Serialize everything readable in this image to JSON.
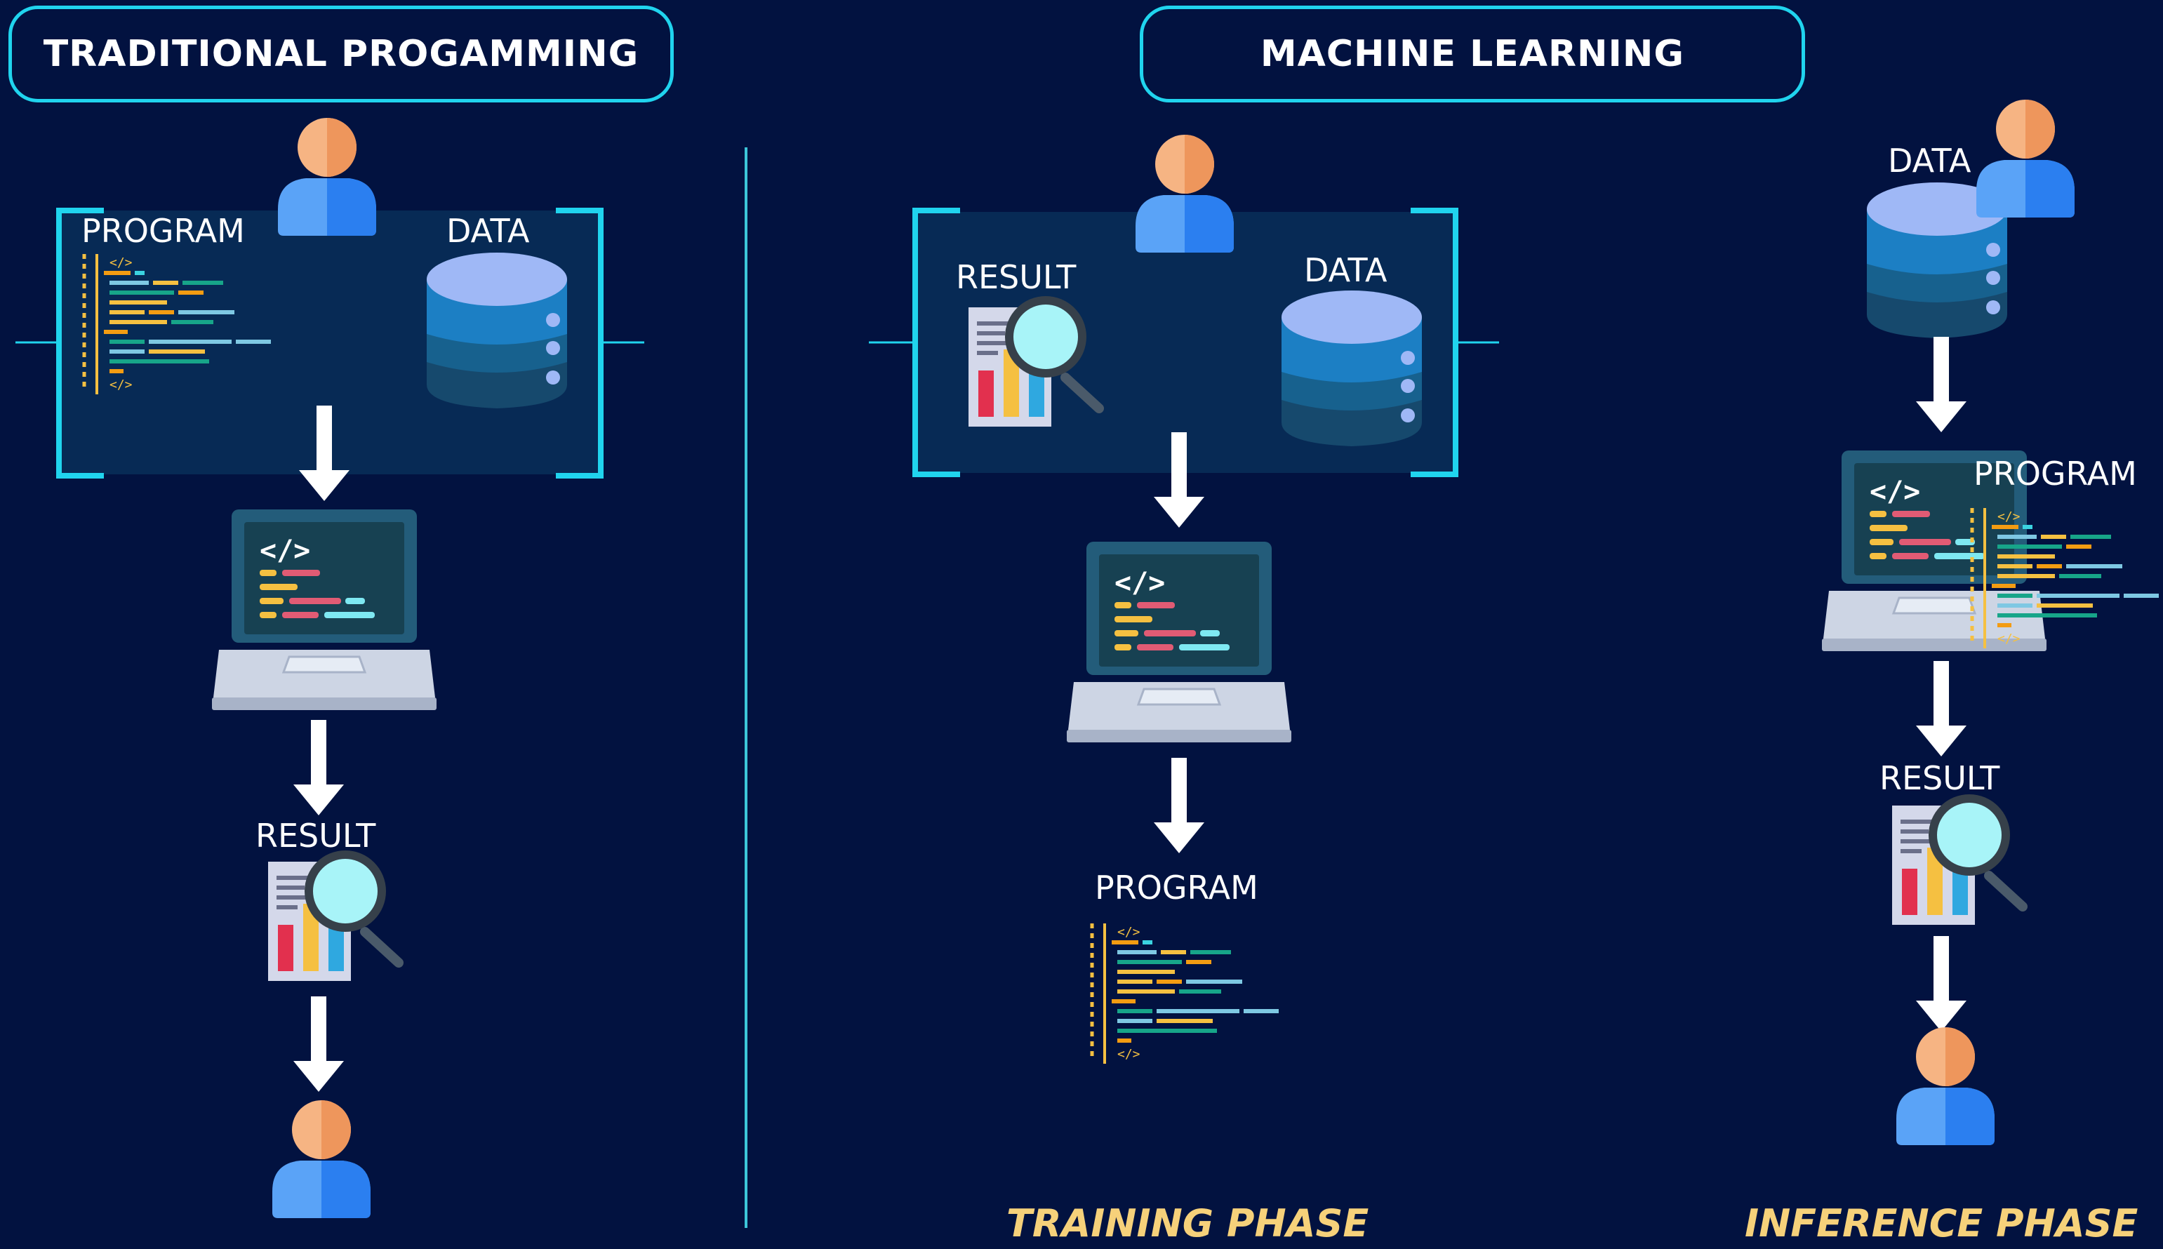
{
  "headers": {
    "traditional": "TRADITIONAL PROGAMMING",
    "ml": "MACHINE LEARNING"
  },
  "traditional": {
    "program_label": "PROGRAM",
    "data_label": "DATA",
    "result_label": "RESULT"
  },
  "training": {
    "result_label": "RESULT",
    "data_label": "DATA",
    "program_label": "PROGRAM",
    "phase_label": "TRAINING PHASE"
  },
  "inference": {
    "data_label": "DATA",
    "program_label": "PROGRAM",
    "result_label": "RESULT",
    "phase_label": "INFERENCE PHASE"
  },
  "colors": {
    "background": "#021240",
    "accent": "#20d4ee",
    "phase_text": "#f6d17a"
  }
}
